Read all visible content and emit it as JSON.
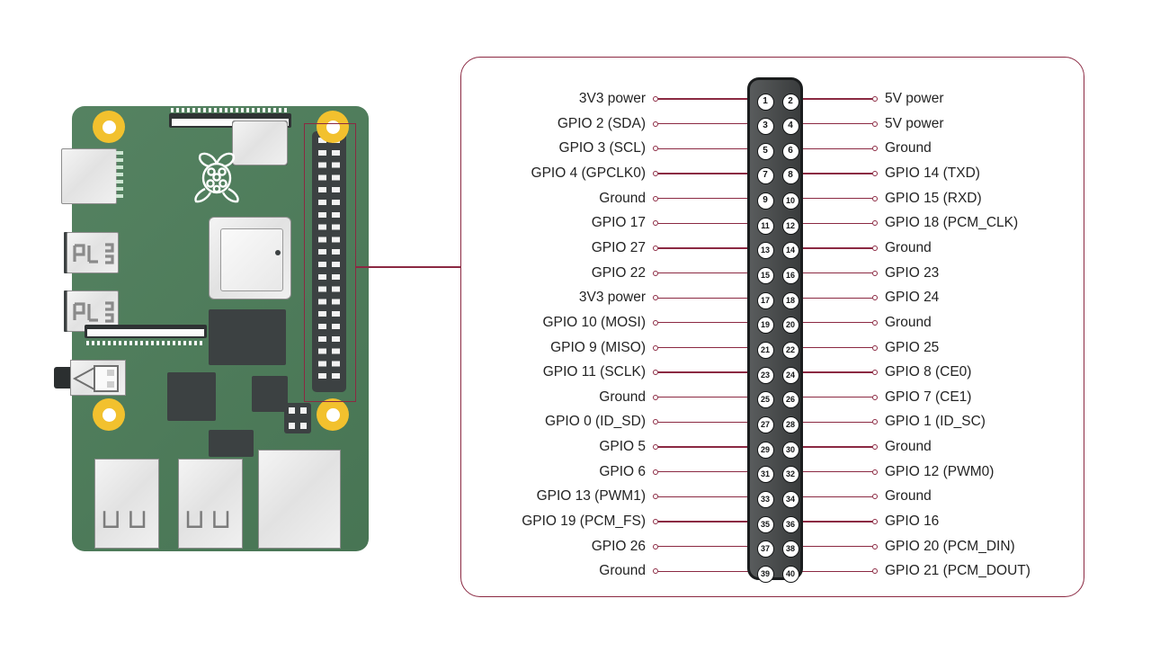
{
  "diagram": {
    "title": "Raspberry Pi 40-pin GPIO header pinout",
    "accent_color": "#8B2942",
    "pcb_color": "#4C7C59",
    "connector_color": "#46494A",
    "mount_hole_color": "#F2C12E",
    "label_color": "#232323"
  },
  "board": {
    "name": "raspberry-pi-board",
    "logo": "raspberry-logo",
    "usb_glyph": "⊔⊔"
  },
  "pins": [
    {
      "number": "1",
      "side": "left",
      "label": "3V3 power"
    },
    {
      "number": "2",
      "side": "right",
      "label": "5V power"
    },
    {
      "number": "3",
      "side": "left",
      "label": "GPIO 2 (SDA)"
    },
    {
      "number": "4",
      "side": "right",
      "label": "5V power"
    },
    {
      "number": "5",
      "side": "left",
      "label": "GPIO 3 (SCL)"
    },
    {
      "number": "6",
      "side": "right",
      "label": "Ground"
    },
    {
      "number": "7",
      "side": "left",
      "label": "GPIO 4 (GPCLK0)"
    },
    {
      "number": "8",
      "side": "right",
      "label": "GPIO 14 (TXD)"
    },
    {
      "number": "9",
      "side": "left",
      "label": "Ground"
    },
    {
      "number": "10",
      "side": "right",
      "label": "GPIO 15 (RXD)"
    },
    {
      "number": "11",
      "side": "left",
      "label": "GPIO 17"
    },
    {
      "number": "12",
      "side": "right",
      "label": "GPIO 18 (PCM_CLK)"
    },
    {
      "number": "13",
      "side": "left",
      "label": "GPIO 27"
    },
    {
      "number": "14",
      "side": "right",
      "label": "Ground"
    },
    {
      "number": "15",
      "side": "left",
      "label": "GPIO 22"
    },
    {
      "number": "16",
      "side": "right",
      "label": "GPIO 23"
    },
    {
      "number": "17",
      "side": "left",
      "label": "3V3 power"
    },
    {
      "number": "18",
      "side": "right",
      "label": "GPIO 24"
    },
    {
      "number": "19",
      "side": "left",
      "label": "GPIO 10 (MOSI)"
    },
    {
      "number": "20",
      "side": "right",
      "label": "Ground"
    },
    {
      "number": "21",
      "side": "left",
      "label": "GPIO 9 (MISO)"
    },
    {
      "number": "22",
      "side": "right",
      "label": "GPIO 25"
    },
    {
      "number": "23",
      "side": "left",
      "label": "GPIO 11 (SCLK)"
    },
    {
      "number": "24",
      "side": "right",
      "label": "GPIO 8 (CE0)"
    },
    {
      "number": "25",
      "side": "left",
      "label": "Ground"
    },
    {
      "number": "26",
      "side": "right",
      "label": "GPIO 7 (CE1)"
    },
    {
      "number": "27",
      "side": "left",
      "label": "GPIO 0 (ID_SD)"
    },
    {
      "number": "28",
      "side": "right",
      "label": "GPIO 1 (ID_SC)"
    },
    {
      "number": "29",
      "side": "left",
      "label": "GPIO 5"
    },
    {
      "number": "30",
      "side": "right",
      "label": "Ground"
    },
    {
      "number": "31",
      "side": "left",
      "label": "GPIO 6"
    },
    {
      "number": "32",
      "side": "right",
      "label": "GPIO 12 (PWM0)"
    },
    {
      "number": "33",
      "side": "left",
      "label": "GPIO 13 (PWM1)"
    },
    {
      "number": "34",
      "side": "right",
      "label": "Ground"
    },
    {
      "number": "35",
      "side": "left",
      "label": "GPIO 19 (PCM_FS)"
    },
    {
      "number": "36",
      "side": "right",
      "label": "GPIO 16"
    },
    {
      "number": "37",
      "side": "left",
      "label": "GPIO 26"
    },
    {
      "number": "38",
      "side": "right",
      "label": "GPIO 20 (PCM_DIN)"
    },
    {
      "number": "39",
      "side": "left",
      "label": "Ground"
    },
    {
      "number": "40",
      "side": "right",
      "label": "GPIO 21 (PCM_DOUT)"
    }
  ]
}
